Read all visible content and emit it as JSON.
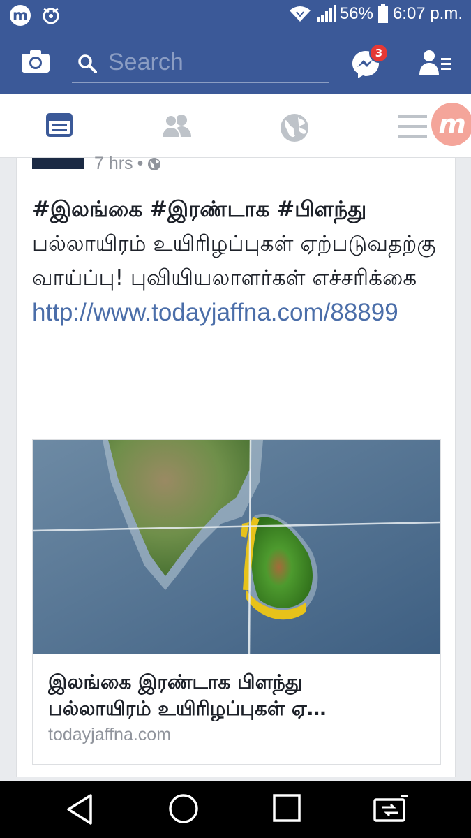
{
  "status_bar": {
    "battery": "56%",
    "time": "6:07 p.m.",
    "app_logo": "m"
  },
  "search": {
    "placeholder": "Search"
  },
  "messenger": {
    "badge_count": "3"
  },
  "icons": {
    "camera": "camera-icon",
    "messenger": "messenger-icon",
    "friend_requests": "friend-requests-icon",
    "news_feed": "news-feed-icon",
    "friends": "friends-icon",
    "globe": "globe-icon",
    "menu": "menu-icon"
  },
  "floating_bubble": {
    "label": "m"
  },
  "post": {
    "time": "7 hrs",
    "hashtags": [
      "#இலங்கை",
      "#இரண்டாக",
      "#பிளந்து"
    ],
    "body": "பல்லாயிரம் உயிரிழப்புகள் ஏற்படுவதற்கு வாய்ப்பு! புவியியலாளர்கள் எச்சரிக்கை",
    "url": "http://www.todayjaffna.com/88899"
  },
  "link_preview": {
    "title_line1": "இலங்கை இரண்டாக பிளந்து",
    "title_line2": "பல்லாயிரம் உயிரிழப்புகள் ஏ…",
    "domain": "todayjaffna.com"
  },
  "colors": {
    "facebook_blue": "#3b5998",
    "link_blue": "#4b6ea9",
    "badge_red": "#e53935"
  }
}
